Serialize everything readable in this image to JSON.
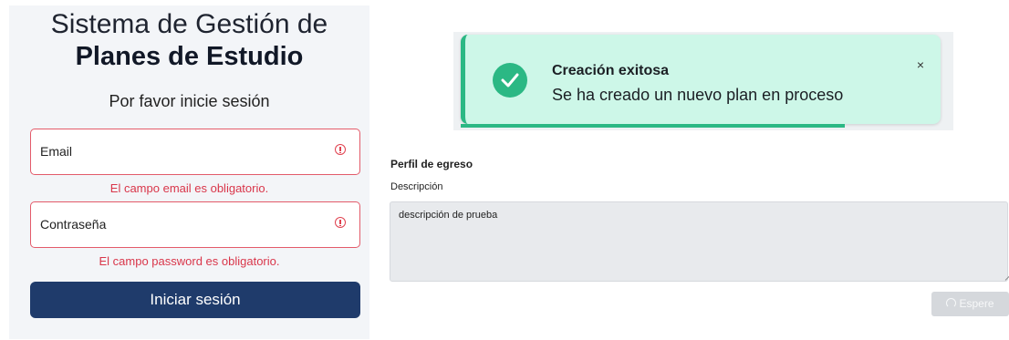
{
  "login": {
    "title_line1": "Sistema de Gestión de",
    "title_line2": "Planes de Estudio",
    "subtitle": "Por favor inicie sesión",
    "email": {
      "label": "Email",
      "error": "El campo email es obligatorio."
    },
    "password": {
      "label": "Contraseña",
      "error": "El campo password es obligatorio."
    },
    "submit_label": "Iniciar sesión"
  },
  "toast": {
    "title": "Creación exitosa",
    "message": "Se ha creado un nuevo plan en proceso",
    "close_symbol": "×",
    "progress_fraction": 0.8
  },
  "form": {
    "section_title": "Perfil de egreso",
    "description_label": "Descripción",
    "description_value": "descripción de prueba",
    "wait_button_label": "Espere"
  },
  "colors": {
    "primary": "#1f3b6b",
    "error": "#d9364a",
    "success": "#2bb884",
    "toast_bg": "#cdf7e8"
  },
  "icons": {
    "field_error": "exclamation-circle-icon",
    "toast_success": "check-circle-icon",
    "toast_close": "close-icon",
    "spinner": "spinner-icon"
  }
}
